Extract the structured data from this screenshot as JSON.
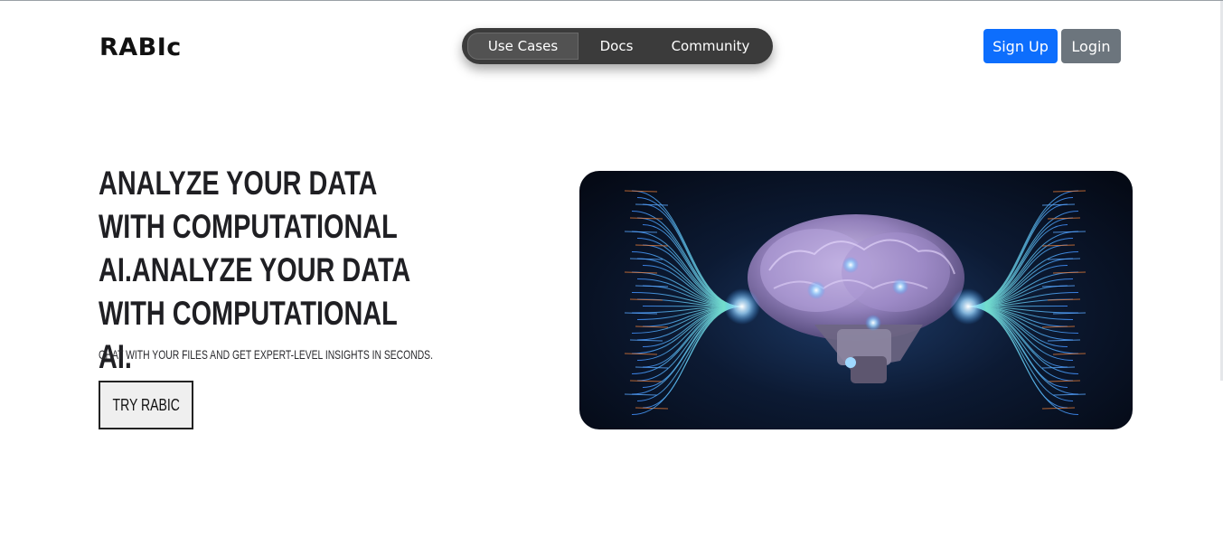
{
  "header": {
    "brand": "RABIc",
    "nav": [
      {
        "label": "Use Cases",
        "active": true
      },
      {
        "label": "Docs",
        "active": false
      },
      {
        "label": "Community",
        "active": false
      }
    ],
    "signup_label": "Sign Up",
    "login_label": "Login"
  },
  "hero": {
    "headline": "ANALYZE YOUR DATA WITH COMPUTATIONAL AI.ANALYZE YOUR DATA WITH COMPUTATIONAL AI.",
    "subline": "CHAT WITH YOUR FILES AND GET EXPERT-LEVEL INSIGHTS IN SECONDS.",
    "cta_label": "TRY RABIC",
    "image_icon": "ai-brain-illustration"
  },
  "colors": {
    "primary": "#0d6efd",
    "secondary": "#6c757d",
    "nav_bg": "#3b3b3b",
    "text_dark": "#1f1f23"
  }
}
